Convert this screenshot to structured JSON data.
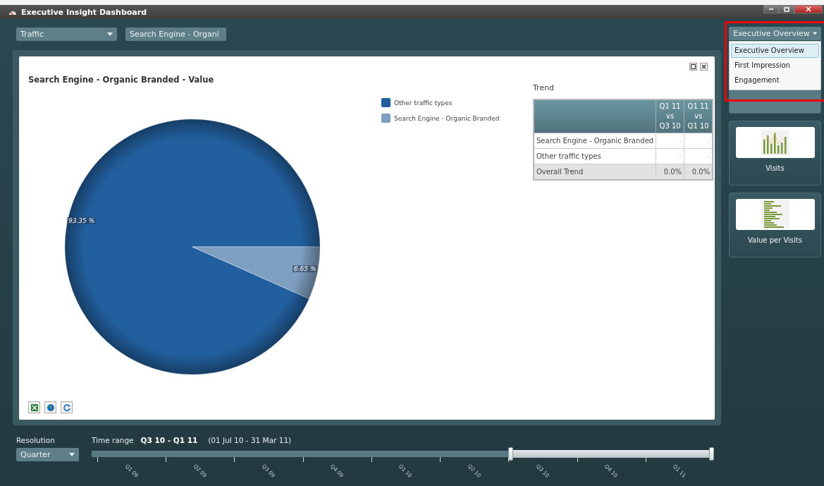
{
  "window": {
    "title": "Executive Insight Dashboard"
  },
  "filters": [
    {
      "value": "Traffic"
    },
    {
      "value": "Search Engine - Organi"
    }
  ],
  "panel": {
    "title": "Search Engine - Organic Branded - Value",
    "chart_data": {
      "type": "pie",
      "categories": [
        "Other traffic types",
        "Search Engine - Organic Branded"
      ],
      "series": [
        {
          "values": [
            93.35,
            6.65
          ]
        }
      ],
      "value_labels": [
        "93.35 %",
        "6.65 %"
      ]
    },
    "legend": [
      {
        "color": "#225f9e"
      },
      {
        "color": "#7f9fc1"
      }
    ],
    "trend": {
      "title": "Trend",
      "columns": [
        "Q1 11\nvs\nQ3 10",
        "Q1 11\nvs\nQ1 10"
      ],
      "rows": [
        {
          "kind": "data",
          "label": "Search Engine - Organic Branded",
          "cells": [
            "-",
            "-"
          ]
        },
        {
          "kind": "data",
          "label": "Other traffic types",
          "cells": [
            "-",
            "-"
          ]
        },
        {
          "kind": "total",
          "label": "Overall Trend",
          "cells": [
            "0.0%",
            "0.0%"
          ]
        }
      ]
    }
  },
  "view_selector": {
    "value": "Executive Overview",
    "options": [
      {
        "label": "Executive Overview",
        "selected": true
      },
      {
        "label": "First Impression",
        "selected": false
      },
      {
        "label": "Engagement",
        "selected": false
      }
    ]
  },
  "cards": [
    {
      "kind": "covered"
    },
    {
      "kind": "columns",
      "label": "Visits"
    },
    {
      "kind": "rows",
      "label": "Value per Visits"
    }
  ],
  "resolution": {
    "label": "Resolution",
    "value": "Quarter"
  },
  "time_range": {
    "label": "Time range",
    "range": "Q3 10 - Q1 11",
    "dates": "(01 Jul 10 - 31 Mar 11)",
    "periods": [
      {
        "label": "Q1 09",
        "selected": false
      },
      {
        "label": "Q2 09",
        "selected": false
      },
      {
        "label": "Q3 09",
        "selected": false
      },
      {
        "label": "Q4 09",
        "selected": false
      },
      {
        "label": "Q1 10",
        "selected": false
      },
      {
        "label": "Q2 10",
        "selected": false
      },
      {
        "label": "Q3 10",
        "selected": true
      },
      {
        "label": "Q4 10",
        "selected": true
      },
      {
        "label": "Q1 11",
        "selected": true
      }
    ]
  }
}
